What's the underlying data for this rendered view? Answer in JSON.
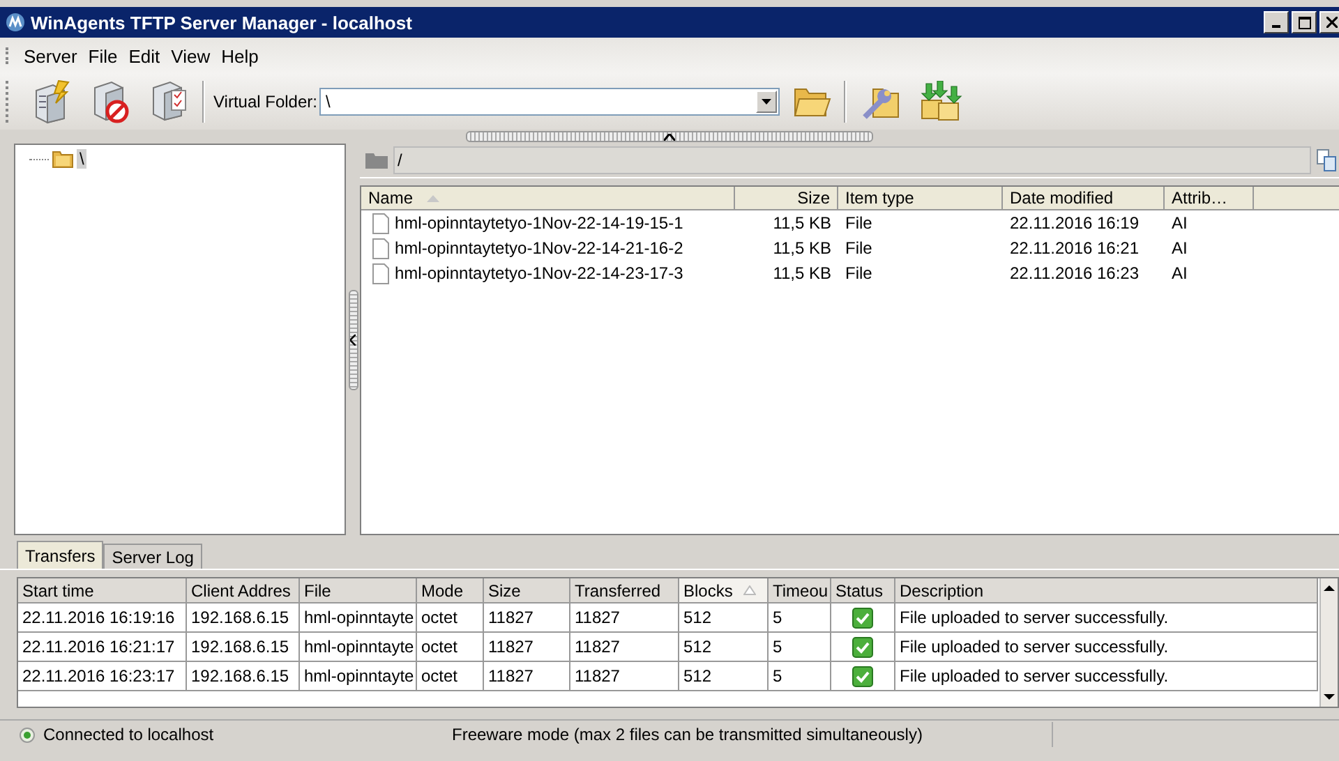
{
  "window": {
    "title": "WinAgents TFTP Server Manager - localhost"
  },
  "menu": [
    "Server",
    "File",
    "Edit",
    "View",
    "Help"
  ],
  "toolbar": {
    "virtual_folder_label": "Virtual Folder:",
    "virtual_folder_value": "\\"
  },
  "tree": [
    {
      "label": "\\",
      "selected": true
    }
  ],
  "path": "/",
  "files": {
    "columns": [
      {
        "label": "Name",
        "sorted": true
      },
      {
        "label": "Size",
        "sorted": false
      },
      {
        "label": "Item type",
        "sorted": false
      },
      {
        "label": "Date modified",
        "sorted": false
      },
      {
        "label": "Attrib…",
        "sorted": false
      }
    ],
    "rows": [
      {
        "name": "hml-opinntaytetyo-1Nov-22-14-19-15-1",
        "size": "11,5 KB",
        "type": "File",
        "date": "22.11.2016 16:19",
        "attrib": "AI"
      },
      {
        "name": "hml-opinntaytetyo-1Nov-22-14-21-16-2",
        "size": "11,5 KB",
        "type": "File",
        "date": "22.11.2016 16:21",
        "attrib": "AI"
      },
      {
        "name": "hml-opinntaytetyo-1Nov-22-14-23-17-3",
        "size": "11,5 KB",
        "type": "File",
        "date": "22.11.2016 16:23",
        "attrib": "AI"
      }
    ]
  },
  "tabs": [
    {
      "label": "Transfers",
      "selected": true
    },
    {
      "label": "Server Log",
      "selected": false
    }
  ],
  "transfers": {
    "columns": [
      {
        "label": "Start time",
        "sorted": false
      },
      {
        "label": "Client Addres",
        "sorted": false
      },
      {
        "label": "File",
        "sorted": false
      },
      {
        "label": "Mode",
        "sorted": false
      },
      {
        "label": "Size",
        "sorted": false
      },
      {
        "label": "Transferred",
        "sorted": false
      },
      {
        "label": "Blocks",
        "sorted": true
      },
      {
        "label": "Timeou",
        "sorted": false
      },
      {
        "label": "Status",
        "sorted": false
      },
      {
        "label": "Description",
        "sorted": false
      }
    ],
    "rows": [
      {
        "start": "22.11.2016 16:19:16",
        "client": "192.168.6.15",
        "file": "hml-opinntayte",
        "mode": "octet",
        "size": "11827",
        "transferred": "11827",
        "blocks": "512",
        "timeout": "5",
        "ok": true,
        "description": "File uploaded to server successfully."
      },
      {
        "start": "22.11.2016 16:21:17",
        "client": "192.168.6.15",
        "file": "hml-opinntayte",
        "mode": "octet",
        "size": "11827",
        "transferred": "11827",
        "blocks": "512",
        "timeout": "5",
        "ok": true,
        "description": "File uploaded to server successfully."
      },
      {
        "start": "22.11.2016 16:23:17",
        "client": "192.168.6.15",
        "file": "hml-opinntayte",
        "mode": "octet",
        "size": "11827",
        "transferred": "11827",
        "blocks": "512",
        "timeout": "5",
        "ok": true,
        "description": "File uploaded to server successfully."
      }
    ]
  },
  "status_bar": {
    "connected": true,
    "connection": "Connected to localhost",
    "mode": "Freeware mode (max 2 files can be transmitted simultaneously)"
  }
}
